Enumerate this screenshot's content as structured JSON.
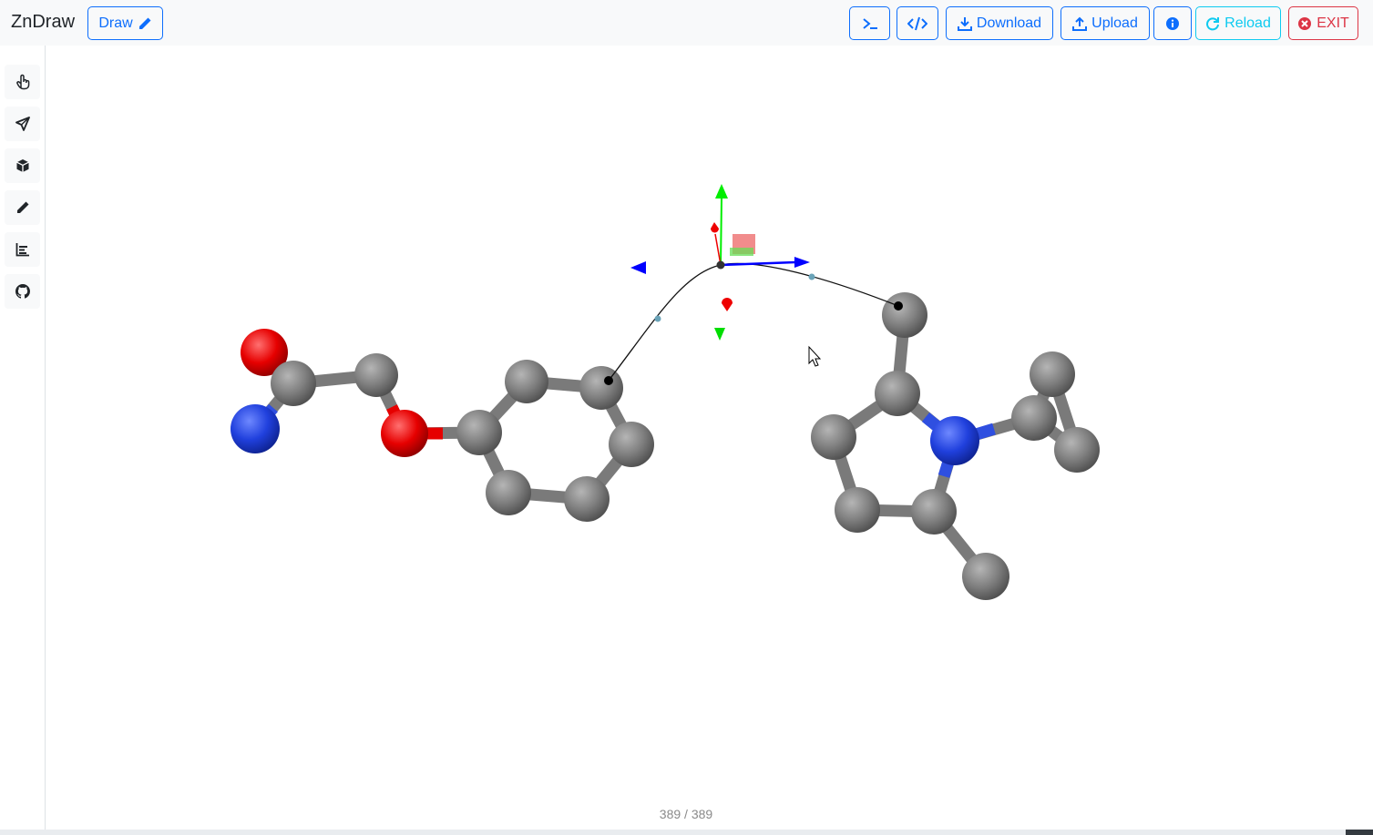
{
  "app": {
    "title": "ZnDraw"
  },
  "header": {
    "draw_label": "Draw",
    "download_label": "Download",
    "upload_label": "Upload",
    "reload_label": "Reload",
    "exit_label": "EXIT"
  },
  "sidebar": {
    "items": [
      {
        "name": "pointer",
        "icon": "hand-pointer-icon"
      },
      {
        "name": "send",
        "icon": "paper-plane-icon"
      },
      {
        "name": "geometry",
        "icon": "cube-icon"
      },
      {
        "name": "draw",
        "icon": "pencil-icon"
      },
      {
        "name": "analysis",
        "icon": "bar-chart-icon"
      },
      {
        "name": "github",
        "icon": "github-icon"
      }
    ]
  },
  "viewer": {
    "frame_counter": "389 / 389",
    "atom_colors": {
      "carbon": "#7f7f7f",
      "oxygen": "#e60000",
      "nitrogen": "#2040dd"
    }
  },
  "colors": {
    "primary": "#0d6efd",
    "info": "#0dcaf0",
    "danger": "#dc3545",
    "navbar_bg": "#f8f9fa"
  }
}
